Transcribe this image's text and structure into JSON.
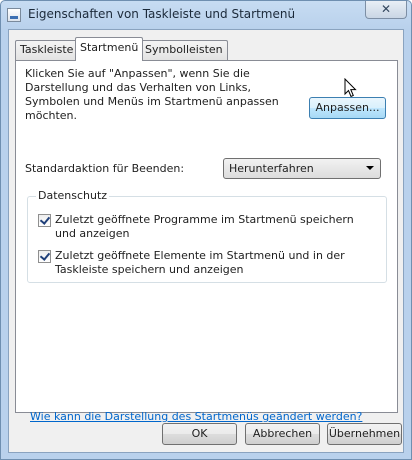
{
  "window": {
    "title": "Eigenschaften von Taskleiste und Startmenü",
    "close_glyph": "✕"
  },
  "tabs": [
    {
      "label": "Taskleiste"
    },
    {
      "label": "Startmenü"
    },
    {
      "label": "Symbolleisten"
    }
  ],
  "startmenu": {
    "description": "Klicken Sie auf \"Anpassen\", wenn Sie die Darstellung und das Verhalten von Links, Symbolen und Menüs im Startmenü anpassen möchten.",
    "customize_button": "Anpassen...",
    "power_action_label": "Standardaktion für Beenden:",
    "power_action_value": "Herunterfahren",
    "privacy": {
      "title": "Datenschutz",
      "options": [
        {
          "label": "Zuletzt geöffnete Programme im Startmenü speichern und anzeigen",
          "checked": true
        },
        {
          "label": "Zuletzt geöffnete Elemente im Startmenü und in der Taskleiste speichern und anzeigen",
          "checked": true
        }
      ]
    },
    "help_link": "Wie kann die Darstellung des Startmenüs geändert werden?"
  },
  "footer": {
    "ok": "OK",
    "cancel": "Abbrechen",
    "apply": "Übernehmen"
  }
}
